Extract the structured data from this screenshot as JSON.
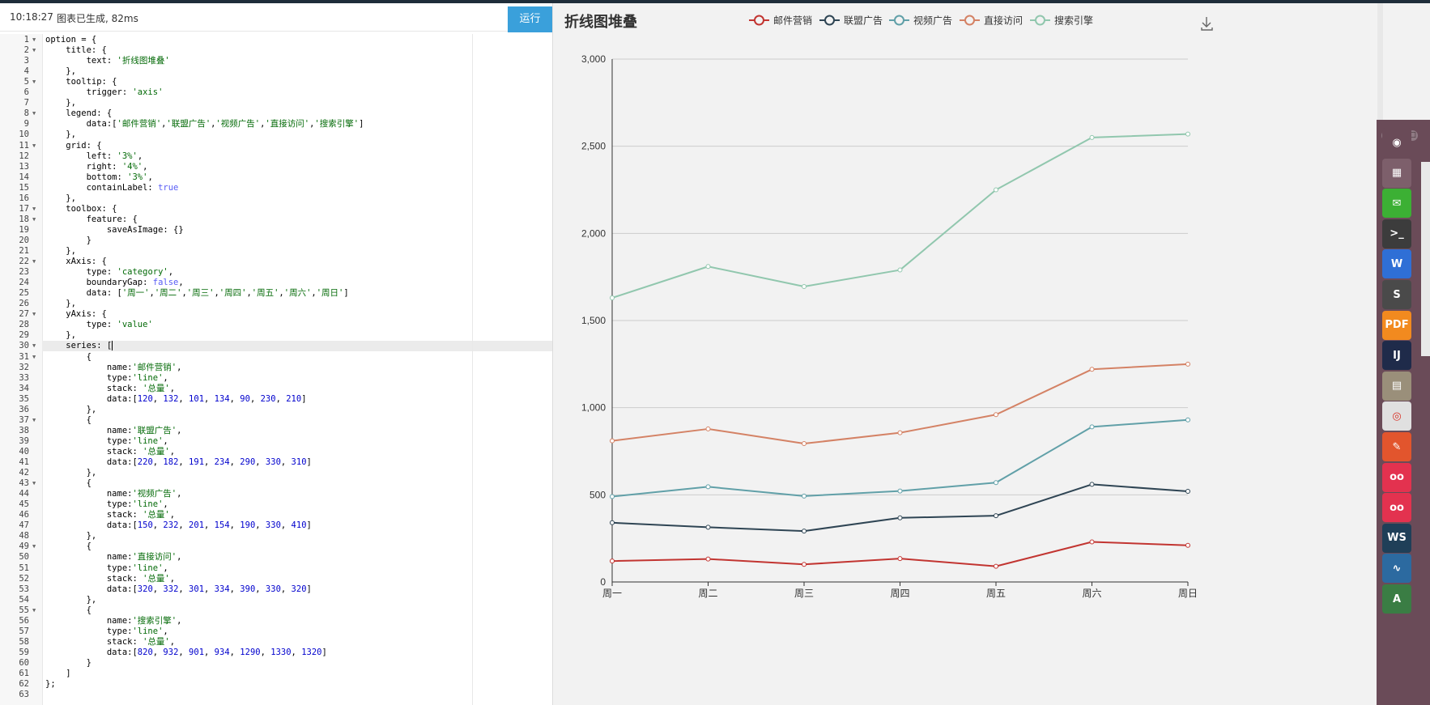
{
  "status": {
    "time": "10:18:27",
    "message": "图表已生成, 82ms"
  },
  "toolbar": {
    "run_label": "运行"
  },
  "editor": {
    "active_line": 30,
    "lines": [
      [
        [
          "p",
          "option = {"
        ]
      ],
      [
        [
          "p",
          "    title: {"
        ]
      ],
      [
        [
          "p",
          "        text: "
        ],
        [
          "s",
          "'折线图堆叠'"
        ]
      ],
      [
        [
          "p",
          "    },"
        ]
      ],
      [
        [
          "p",
          "    tooltip: {"
        ]
      ],
      [
        [
          "p",
          "        trigger: "
        ],
        [
          "s",
          "'axis'"
        ]
      ],
      [
        [
          "p",
          "    },"
        ]
      ],
      [
        [
          "p",
          "    legend: {"
        ]
      ],
      [
        [
          "p",
          "        data:["
        ],
        [
          "s",
          "'邮件营销'"
        ],
        [
          "p",
          ","
        ],
        [
          "s",
          "'联盟广告'"
        ],
        [
          "p",
          ","
        ],
        [
          "s",
          "'视频广告'"
        ],
        [
          "p",
          ","
        ],
        [
          "s",
          "'直接访问'"
        ],
        [
          "p",
          ","
        ],
        [
          "s",
          "'搜索引擎'"
        ],
        [
          "p",
          "]"
        ]
      ],
      [
        [
          "p",
          "    },"
        ]
      ],
      [
        [
          "p",
          "    grid: {"
        ]
      ],
      [
        [
          "p",
          "        left: "
        ],
        [
          "s",
          "'3%'"
        ],
        [
          "p",
          ","
        ]
      ],
      [
        [
          "p",
          "        right: "
        ],
        [
          "s",
          "'4%'"
        ],
        [
          "p",
          ","
        ]
      ],
      [
        [
          "p",
          "        bottom: "
        ],
        [
          "s",
          "'3%'"
        ],
        [
          "p",
          ","
        ]
      ],
      [
        [
          "p",
          "        containLabel: "
        ],
        [
          "b",
          "true"
        ]
      ],
      [
        [
          "p",
          "    },"
        ]
      ],
      [
        [
          "p",
          "    toolbox: {"
        ]
      ],
      [
        [
          "p",
          "        feature: {"
        ]
      ],
      [
        [
          "p",
          "            saveAsImage: {}"
        ]
      ],
      [
        [
          "p",
          "        }"
        ]
      ],
      [
        [
          "p",
          "    },"
        ]
      ],
      [
        [
          "p",
          "    xAxis: {"
        ]
      ],
      [
        [
          "p",
          "        type: "
        ],
        [
          "s",
          "'category'"
        ],
        [
          "p",
          ","
        ]
      ],
      [
        [
          "p",
          "        boundaryGap: "
        ],
        [
          "b",
          "false"
        ],
        [
          "p",
          ","
        ]
      ],
      [
        [
          "p",
          "        data: ["
        ],
        [
          "s",
          "'周一'"
        ],
        [
          "p",
          ","
        ],
        [
          "s",
          "'周二'"
        ],
        [
          "p",
          ","
        ],
        [
          "s",
          "'周三'"
        ],
        [
          "p",
          ","
        ],
        [
          "s",
          "'周四'"
        ],
        [
          "p",
          ","
        ],
        [
          "s",
          "'周五'"
        ],
        [
          "p",
          ","
        ],
        [
          "s",
          "'周六'"
        ],
        [
          "p",
          ","
        ],
        [
          "s",
          "'周日'"
        ],
        [
          "p",
          "]"
        ]
      ],
      [
        [
          "p",
          "    },"
        ]
      ],
      [
        [
          "p",
          "    yAxis: {"
        ]
      ],
      [
        [
          "p",
          "        type: "
        ],
        [
          "s",
          "'value'"
        ]
      ],
      [
        [
          "p",
          "    },"
        ]
      ],
      [
        [
          "p",
          "    series: ["
        ]
      ],
      [
        [
          "p",
          "        {"
        ]
      ],
      [
        [
          "p",
          "            name:"
        ],
        [
          "s",
          "'邮件营销'"
        ],
        [
          "p",
          ","
        ]
      ],
      [
        [
          "p",
          "            type:"
        ],
        [
          "s",
          "'line'"
        ],
        [
          "p",
          ","
        ]
      ],
      [
        [
          "p",
          "            stack: "
        ],
        [
          "s",
          "'总量'"
        ],
        [
          "p",
          ","
        ]
      ],
      [
        [
          "p",
          "            data:["
        ],
        [
          "n",
          "120"
        ],
        [
          "p",
          ", "
        ],
        [
          "n",
          "132"
        ],
        [
          "p",
          ", "
        ],
        [
          "n",
          "101"
        ],
        [
          "p",
          ", "
        ],
        [
          "n",
          "134"
        ],
        [
          "p",
          ", "
        ],
        [
          "n",
          "90"
        ],
        [
          "p",
          ", "
        ],
        [
          "n",
          "230"
        ],
        [
          "p",
          ", "
        ],
        [
          "n",
          "210"
        ],
        [
          "p",
          "]"
        ]
      ],
      [
        [
          "p",
          "        },"
        ]
      ],
      [
        [
          "p",
          "        {"
        ]
      ],
      [
        [
          "p",
          "            name:"
        ],
        [
          "s",
          "'联盟广告'"
        ],
        [
          "p",
          ","
        ]
      ],
      [
        [
          "p",
          "            type:"
        ],
        [
          "s",
          "'line'"
        ],
        [
          "p",
          ","
        ]
      ],
      [
        [
          "p",
          "            stack: "
        ],
        [
          "s",
          "'总量'"
        ],
        [
          "p",
          ","
        ]
      ],
      [
        [
          "p",
          "            data:["
        ],
        [
          "n",
          "220"
        ],
        [
          "p",
          ", "
        ],
        [
          "n",
          "182"
        ],
        [
          "p",
          ", "
        ],
        [
          "n",
          "191"
        ],
        [
          "p",
          ", "
        ],
        [
          "n",
          "234"
        ],
        [
          "p",
          ", "
        ],
        [
          "n",
          "290"
        ],
        [
          "p",
          ", "
        ],
        [
          "n",
          "330"
        ],
        [
          "p",
          ", "
        ],
        [
          "n",
          "310"
        ],
        [
          "p",
          "]"
        ]
      ],
      [
        [
          "p",
          "        },"
        ]
      ],
      [
        [
          "p",
          "        {"
        ]
      ],
      [
        [
          "p",
          "            name:"
        ],
        [
          "s",
          "'视频广告'"
        ],
        [
          "p",
          ","
        ]
      ],
      [
        [
          "p",
          "            type:"
        ],
        [
          "s",
          "'line'"
        ],
        [
          "p",
          ","
        ]
      ],
      [
        [
          "p",
          "            stack: "
        ],
        [
          "s",
          "'总量'"
        ],
        [
          "p",
          ","
        ]
      ],
      [
        [
          "p",
          "            data:["
        ],
        [
          "n",
          "150"
        ],
        [
          "p",
          ", "
        ],
        [
          "n",
          "232"
        ],
        [
          "p",
          ", "
        ],
        [
          "n",
          "201"
        ],
        [
          "p",
          ", "
        ],
        [
          "n",
          "154"
        ],
        [
          "p",
          ", "
        ],
        [
          "n",
          "190"
        ],
        [
          "p",
          ", "
        ],
        [
          "n",
          "330"
        ],
        [
          "p",
          ", "
        ],
        [
          "n",
          "410"
        ],
        [
          "p",
          "]"
        ]
      ],
      [
        [
          "p",
          "        },"
        ]
      ],
      [
        [
          "p",
          "        {"
        ]
      ],
      [
        [
          "p",
          "            name:"
        ],
        [
          "s",
          "'直接访问'"
        ],
        [
          "p",
          ","
        ]
      ],
      [
        [
          "p",
          "            type:"
        ],
        [
          "s",
          "'line'"
        ],
        [
          "p",
          ","
        ]
      ],
      [
        [
          "p",
          "            stack: "
        ],
        [
          "s",
          "'总量'"
        ],
        [
          "p",
          ","
        ]
      ],
      [
        [
          "p",
          "            data:["
        ],
        [
          "n",
          "320"
        ],
        [
          "p",
          ", "
        ],
        [
          "n",
          "332"
        ],
        [
          "p",
          ", "
        ],
        [
          "n",
          "301"
        ],
        [
          "p",
          ", "
        ],
        [
          "n",
          "334"
        ],
        [
          "p",
          ", "
        ],
        [
          "n",
          "390"
        ],
        [
          "p",
          ", "
        ],
        [
          "n",
          "330"
        ],
        [
          "p",
          ", "
        ],
        [
          "n",
          "320"
        ],
        [
          "p",
          "]"
        ]
      ],
      [
        [
          "p",
          "        },"
        ]
      ],
      [
        [
          "p",
          "        {"
        ]
      ],
      [
        [
          "p",
          "            name:"
        ],
        [
          "s",
          "'搜索引擎'"
        ],
        [
          "p",
          ","
        ]
      ],
      [
        [
          "p",
          "            type:"
        ],
        [
          "s",
          "'line'"
        ],
        [
          "p",
          ","
        ]
      ],
      [
        [
          "p",
          "            stack: "
        ],
        [
          "s",
          "'总量'"
        ],
        [
          "p",
          ","
        ]
      ],
      [
        [
          "p",
          "            data:["
        ],
        [
          "n",
          "820"
        ],
        [
          "p",
          ", "
        ],
        [
          "n",
          "932"
        ],
        [
          "p",
          ", "
        ],
        [
          "n",
          "901"
        ],
        [
          "p",
          ", "
        ],
        [
          "n",
          "934"
        ],
        [
          "p",
          ", "
        ],
        [
          "n",
          "1290"
        ],
        [
          "p",
          ", "
        ],
        [
          "n",
          "1330"
        ],
        [
          "p",
          ", "
        ],
        [
          "n",
          "1320"
        ],
        [
          "p",
          "]"
        ]
      ],
      [
        [
          "p",
          "        }"
        ]
      ],
      [
        [
          "p",
          "    ]"
        ]
      ],
      [
        [
          "p",
          "};"
        ]
      ],
      [
        [
          "p",
          ""
        ]
      ]
    ]
  },
  "dock": {
    "items": [
      {
        "name": "ubuntu-logo-icon",
        "label": "◉",
        "color": "#6a4b58"
      },
      {
        "name": "workspace-switcher-icon",
        "label": "▦",
        "color": "#7d5f6b"
      },
      {
        "name": "wechat-icon",
        "label": "✉",
        "color": "#3cb034"
      },
      {
        "name": "terminal-icon",
        "label": ">_",
        "color": "#3c3c3c"
      },
      {
        "name": "wps-writer-icon",
        "label": "W",
        "color": "#2f6fd6"
      },
      {
        "name": "sublime-text-icon",
        "label": "S",
        "color": "#4a4a4a"
      },
      {
        "name": "pdf-reader-icon",
        "label": "PDF",
        "color": "#f28a1f"
      },
      {
        "name": "intellij-idea-icon",
        "label": "IJ",
        "color": "#1f2b4a"
      },
      {
        "name": "files-icon",
        "label": "▤",
        "color": "#9a8f7a"
      },
      {
        "name": "chrome-icon",
        "label": "◎",
        "color": "#e0e0e0"
      },
      {
        "name": "settings-tool-icon",
        "label": "✎",
        "color": "#e2552d"
      },
      {
        "name": "flickr-like-icon-1",
        "label": "oo",
        "color": "#e3324f"
      },
      {
        "name": "flickr-like-icon-2",
        "label": "oo",
        "color": "#e3324f"
      },
      {
        "name": "webstorm-icon",
        "label": "WS",
        "color": "#1f3f58"
      },
      {
        "name": "system-monitor-icon",
        "label": "∿",
        "color": "#2c6aa0"
      },
      {
        "name": "android-studio-icon",
        "label": "A",
        "color": "#3a7d44"
      }
    ]
  },
  "chart_data": {
    "type": "line",
    "title": "折线图堆叠",
    "stacked": true,
    "categories": [
      "周一",
      "周二",
      "周三",
      "周四",
      "周五",
      "周六",
      "周日"
    ],
    "series": [
      {
        "name": "邮件营销",
        "color": "#c23531",
        "values": [
          120,
          132,
          101,
          134,
          90,
          230,
          210
        ]
      },
      {
        "name": "联盟广告",
        "color": "#2f4554",
        "values": [
          220,
          182,
          191,
          234,
          290,
          330,
          310
        ]
      },
      {
        "name": "视频广告",
        "color": "#61a0a8",
        "values": [
          150,
          232,
          201,
          154,
          190,
          330,
          410
        ]
      },
      {
        "name": "直接访问",
        "color": "#d48265",
        "values": [
          320,
          332,
          301,
          334,
          390,
          330,
          320
        ]
      },
      {
        "name": "搜索引擎",
        "color": "#91c7ae",
        "values": [
          820,
          932,
          901,
          934,
          1290,
          1330,
          1320
        ]
      }
    ],
    "ylim": [
      0,
      3000
    ],
    "yticks": [
      0,
      500,
      1000,
      1500,
      2000,
      2500,
      3000
    ],
    "ytick_labels": [
      "0",
      "500",
      "1,000",
      "1,500",
      "2,000",
      "2,500",
      "3,000"
    ],
    "grid": true,
    "legend_position": "top-center",
    "toolbox_icon": "download-icon"
  }
}
